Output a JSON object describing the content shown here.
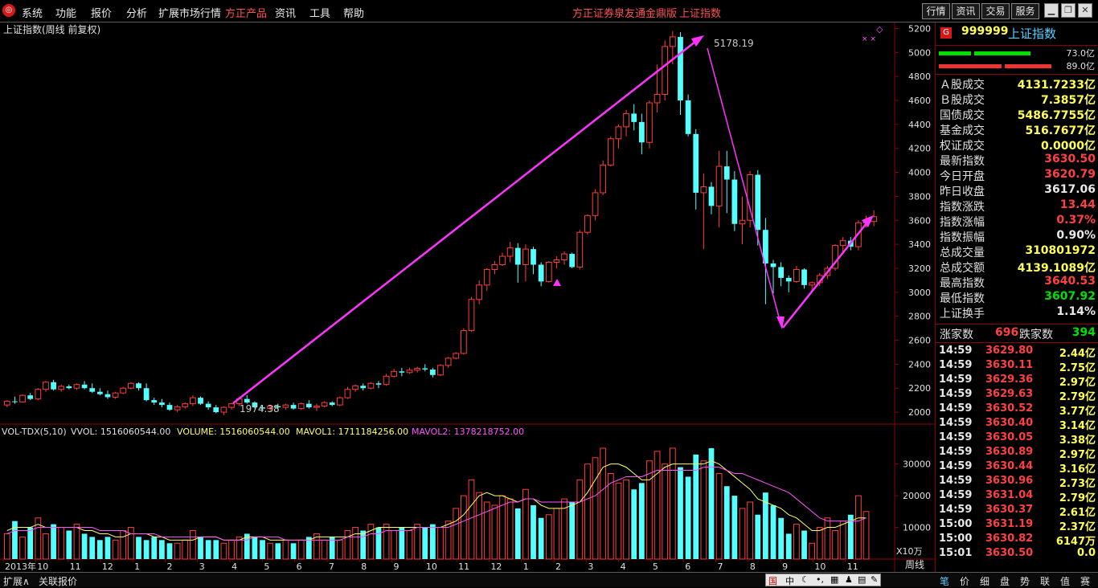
{
  "menubar": {
    "items": [
      "系统",
      "功能",
      "报价",
      "分析",
      "扩展市场行情",
      "方正产品",
      "资讯",
      "工具",
      "帮助"
    ],
    "center_links": [
      "方正证券泉友通金鼎版",
      "上证指数"
    ],
    "right_buttons": [
      "行情",
      "资讯",
      "交易",
      "服务"
    ]
  },
  "chart_title": "上证指数(周线 前复权)",
  "peak_label": "5178.19",
  "low_label": "1974.38",
  "vol_header": {
    "name": "VOL-TDX(5,10)",
    "vvol": "VVOL: 1516060544.00",
    "volume": "VOLUME: 1516060544.00",
    "mavol1": "MAVOL1: 1711184256.00",
    "mavol2": "MAVOL2: 1378218752.00"
  },
  "x10": "X10万",
  "period_label": "周线",
  "bottom_tabs": [
    "扩展∧",
    "关联报价"
  ],
  "colors": {
    "up": "#ff3d3d",
    "down": "#54ffff",
    "ma1": "#ffff66",
    "ma2": "#ff55ff",
    "arrow": "#ff33ff",
    "grid": "#8b0000"
  },
  "chart_data": {
    "type": "candlestick",
    "price_axis": {
      "ticks": [
        2000,
        2200,
        2400,
        2600,
        2800,
        3000,
        3200,
        3400,
        3600,
        3800,
        4000,
        4200,
        4400,
        4600,
        4800,
        5000,
        5200
      ],
      "range": [
        1900,
        5250
      ]
    },
    "volume_axis": {
      "ticks": [
        10000,
        20000,
        30000
      ],
      "range": [
        0,
        36000
      ],
      "unit": "X10万"
    },
    "x_labels": [
      "2013年",
      "10",
      "11",
      "12",
      "1",
      "2",
      "3",
      "4",
      "5",
      "6",
      "7",
      "8",
      "9",
      "10",
      "11",
      "12",
      "1",
      "2",
      "3",
      "4",
      "5",
      "6",
      "7",
      "8",
      "9",
      "10",
      "11"
    ],
    "ohlc": [
      [
        2060,
        2100,
        2040,
        2090
      ],
      [
        2090,
        2130,
        2070,
        2085
      ],
      [
        2085,
        2150,
        2080,
        2140
      ],
      [
        2140,
        2160,
        2100,
        2110
      ],
      [
        2110,
        2200,
        2100,
        2190
      ],
      [
        2190,
        2260,
        2170,
        2250
      ],
      [
        2250,
        2270,
        2180,
        2190
      ],
      [
        2190,
        2230,
        2170,
        2215
      ],
      [
        2215,
        2230,
        2190,
        2200
      ],
      [
        2200,
        2240,
        2185,
        2230
      ],
      [
        2230,
        2260,
        2190,
        2200
      ],
      [
        2200,
        2240,
        2160,
        2170
      ],
      [
        2170,
        2200,
        2140,
        2150
      ],
      [
        2150,
        2180,
        2110,
        2125
      ],
      [
        2125,
        2170,
        2110,
        2160
      ],
      [
        2160,
        2210,
        2150,
        2200
      ],
      [
        2200,
        2250,
        2190,
        2240
      ],
      [
        2240,
        2250,
        2180,
        2200
      ],
      [
        2200,
        2240,
        2090,
        2100
      ],
      [
        2100,
        2120,
        2060,
        2080
      ],
      [
        2080,
        2110,
        2040,
        2060
      ],
      [
        2060,
        2080,
        2010,
        2020
      ],
      [
        2020,
        2060,
        2000,
        2045
      ],
      [
        2045,
        2080,
        2030,
        2070
      ],
      [
        2070,
        2140,
        2050,
        2120
      ],
      [
        2120,
        2130,
        2060,
        2070
      ],
      [
        2070,
        2090,
        2020,
        2040
      ],
      [
        2040,
        2060,
        1990,
        2000
      ],
      [
        2000,
        2050,
        1974,
        2040
      ],
      [
        2040,
        2080,
        2020,
        2070
      ],
      [
        2070,
        2120,
        2050,
        2110
      ],
      [
        2110,
        2140,
        2070,
        2080
      ],
      [
        2080,
        2090,
        2030,
        2040
      ],
      [
        2040,
        2060,
        2010,
        2030
      ],
      [
        2030,
        2060,
        2010,
        2050
      ],
      [
        2050,
        2070,
        2020,
        2040
      ],
      [
        2040,
        2070,
        2020,
        2060
      ],
      [
        2060,
        2080,
        2020,
        2030
      ],
      [
        2030,
        2080,
        2020,
        2070
      ],
      [
        2070,
        2100,
        2030,
        2040
      ],
      [
        2040,
        2070,
        2010,
        2050
      ],
      [
        2050,
        2090,
        2040,
        2080
      ],
      [
        2080,
        2090,
        2050,
        2060
      ],
      [
        2060,
        2130,
        2050,
        2120
      ],
      [
        2120,
        2210,
        2110,
        2190
      ],
      [
        2190,
        2230,
        2170,
        2220
      ],
      [
        2220,
        2240,
        2180,
        2200
      ],
      [
        2200,
        2250,
        2190,
        2240
      ],
      [
        2240,
        2260,
        2200,
        2230
      ],
      [
        2230,
        2320,
        2220,
        2300
      ],
      [
        2300,
        2360,
        2290,
        2340
      ],
      [
        2340,
        2370,
        2300,
        2330
      ],
      [
        2330,
        2370,
        2320,
        2350
      ],
      [
        2350,
        2380,
        2330,
        2365
      ],
      [
        2365,
        2400,
        2340,
        2355
      ],
      [
        2355,
        2370,
        2290,
        2310
      ],
      [
        2310,
        2400,
        2300,
        2390
      ],
      [
        2390,
        2460,
        2370,
        2450
      ],
      [
        2450,
        2500,
        2440,
        2490
      ],
      [
        2490,
        2700,
        2480,
        2680
      ],
      [
        2680,
        2960,
        2670,
        2940
      ],
      [
        2940,
        3100,
        2900,
        3060
      ],
      [
        3060,
        3200,
        3010,
        3190
      ],
      [
        3190,
        3260,
        3150,
        3230
      ],
      [
        3230,
        3330,
        3220,
        3300
      ],
      [
        3300,
        3420,
        3250,
        3370
      ],
      [
        3370,
        3410,
        3080,
        3230
      ],
      [
        3230,
        3400,
        3090,
        3360
      ],
      [
        3360,
        3380,
        3150,
        3230
      ],
      [
        3230,
        3250,
        3050,
        3090
      ],
      [
        3090,
        3260,
        3080,
        3250
      ],
      [
        3250,
        3300,
        3200,
        3270
      ],
      [
        3270,
        3340,
        3230,
        3320
      ],
      [
        3320,
        3330,
        3200,
        3210
      ],
      [
        3210,
        3520,
        3190,
        3500
      ],
      [
        3500,
        3650,
        3480,
        3640
      ],
      [
        3640,
        3860,
        3600,
        3830
      ],
      [
        3830,
        4100,
        3810,
        4060
      ],
      [
        4060,
        4300,
        4050,
        4280
      ],
      [
        4280,
        4400,
        4200,
        4380
      ],
      [
        4380,
        4520,
        4300,
        4490
      ],
      [
        4490,
        4570,
        4350,
        4420
      ],
      [
        4420,
        4490,
        4150,
        4250
      ],
      [
        4250,
        4600,
        4200,
        4580
      ],
      [
        4580,
        4900,
        4500,
        4650
      ],
      [
        4650,
        5100,
        4600,
        5050
      ],
      [
        5050,
        5178,
        4900,
        5130
      ],
      [
        5130,
        5170,
        4480,
        4600
      ],
      [
        4600,
        4650,
        4300,
        4320
      ],
      [
        4320,
        4360,
        3690,
        3830
      ],
      [
        3830,
        3990,
        3360,
        3880
      ],
      [
        3880,
        3920,
        3650,
        3720
      ],
      [
        3720,
        4180,
        3540,
        4050
      ],
      [
        4050,
        4180,
        3660,
        3940
      ],
      [
        3940,
        4010,
        3510,
        3570
      ],
      [
        3570,
        3800,
        3400,
        3600
      ],
      [
        3600,
        4010,
        3540,
        3980
      ],
      [
        3980,
        4020,
        3390,
        3520
      ],
      [
        3520,
        3620,
        2900,
        3240
      ],
      [
        3240,
        3270,
        2990,
        3210
      ],
      [
        3210,
        3250,
        3050,
        3120
      ],
      [
        3120,
        3140,
        3000,
        3090
      ],
      [
        3090,
        3220,
        3080,
        3190
      ],
      [
        3190,
        3200,
        3030,
        3060
      ],
      [
        3060,
        3090,
        3010,
        3080
      ],
      [
        3080,
        3160,
        3050,
        3140
      ],
      [
        3140,
        3220,
        3110,
        3200
      ],
      [
        3200,
        3400,
        3180,
        3390
      ],
      [
        3390,
        3460,
        3320,
        3430
      ],
      [
        3430,
        3460,
        3350,
        3380
      ],
      [
        3380,
        3600,
        3350,
        3580
      ],
      [
        3580,
        3640,
        3540,
        3590
      ],
      [
        3590,
        3684,
        3550,
        3630
      ]
    ],
    "volume": [
      8,
      12,
      7,
      10,
      13,
      8,
      11,
      10,
      9,
      11,
      8,
      7,
      6,
      7,
      6,
      9,
      10,
      7,
      6,
      7,
      6,
      5,
      5,
      6,
      9,
      7,
      6,
      6,
      5,
      6,
      7,
      8,
      7,
      6,
      5,
      5,
      6,
      5,
      6,
      7,
      8,
      6,
      7,
      6,
      9,
      10,
      9,
      11,
      10,
      11,
      9,
      10,
      9,
      11,
      10,
      11,
      10,
      12,
      16,
      20,
      25,
      21,
      18,
      17,
      20,
      19,
      16,
      22,
      17,
      13,
      14,
      16,
      19,
      18,
      25,
      30,
      32,
      35,
      27,
      24,
      25,
      22,
      24,
      31,
      34,
      30,
      35,
      29,
      26,
      33,
      31,
      35,
      27,
      23,
      20,
      16,
      18,
      14,
      21,
      17,
      13,
      8,
      11,
      9,
      5,
      10,
      13,
      9,
      12,
      14,
      20,
      15
    ],
    "mavol1": [
      9,
      10,
      10,
      10,
      11,
      10,
      10,
      10,
      10,
      10,
      9,
      9,
      8,
      8,
      7,
      7,
      8,
      8,
      8,
      7,
      7,
      6,
      6,
      6,
      6,
      7,
      7,
      7,
      6,
      6,
      6,
      7,
      7,
      7,
      6,
      6,
      6,
      6,
      6,
      6,
      7,
      7,
      7,
      7,
      7,
      8,
      8,
      9,
      10,
      10,
      10,
      10,
      10,
      10,
      10,
      10,
      10,
      11,
      12,
      14,
      17,
      20,
      21,
      20,
      20,
      19,
      18,
      19,
      19,
      17,
      16,
      16,
      16,
      17,
      18,
      21,
      25,
      29,
      30,
      30,
      29,
      27,
      25,
      25,
      27,
      29,
      30,
      30,
      30,
      30,
      30,
      31,
      30,
      28,
      26,
      24,
      22,
      19,
      18,
      17,
      16,
      14,
      13,
      11,
      9,
      9,
      10,
      10,
      11,
      12,
      13,
      13
    ],
    "mavol2": [
      8,
      9,
      9,
      9,
      10,
      10,
      10,
      10,
      10,
      10,
      10,
      10,
      9,
      9,
      9,
      9,
      8,
      8,
      8,
      8,
      7,
      7,
      7,
      7,
      7,
      7,
      7,
      7,
      6,
      6,
      6,
      6,
      7,
      7,
      7,
      7,
      6,
      6,
      6,
      6,
      6,
      6,
      6,
      6,
      7,
      7,
      7,
      8,
      8,
      9,
      9,
      9,
      9,
      10,
      10,
      10,
      10,
      10,
      11,
      12,
      13,
      14,
      15,
      16,
      17,
      18,
      18,
      19,
      19,
      18,
      18,
      18,
      18,
      18,
      18,
      19,
      20,
      22,
      24,
      25,
      26,
      26,
      26,
      27,
      28,
      28,
      28,
      28,
      28,
      28,
      29,
      29,
      29,
      28,
      27,
      27,
      26,
      25,
      24,
      23,
      22,
      21,
      19,
      17,
      15,
      13,
      12,
      12,
      12,
      12,
      12,
      13
    ]
  },
  "right_panel": {
    "code": "999999",
    "name": "上证指数",
    "badge": "G",
    "bar1_value": "73.0亿",
    "bar2_value": "89.0亿",
    "stats": [
      {
        "k": "Ａ股成交",
        "v": "4131.7233亿",
        "c": "y"
      },
      {
        "k": "Ｂ股成交",
        "v": "7.3857亿",
        "c": "y"
      },
      {
        "k": "国债成交",
        "v": "5486.7755亿",
        "c": "y"
      },
      {
        "k": "基金成交",
        "v": "516.7677亿",
        "c": "y"
      },
      {
        "k": "权证成交",
        "v": "0.0000亿",
        "c": "y"
      },
      {
        "k": "最新指数",
        "v": "3630.50",
        "c": "r"
      },
      {
        "k": "今日开盘",
        "v": "3620.79",
        "c": "r"
      },
      {
        "k": "昨日收盘",
        "v": "3617.06",
        "c": "w"
      },
      {
        "k": "指数涨跌",
        "v": "13.44",
        "c": "r"
      },
      {
        "k": "指数涨幅",
        "v": "0.37%",
        "c": "r"
      },
      {
        "k": "指数振幅",
        "v": "0.90%",
        "c": "w"
      },
      {
        "k": "总成交量",
        "v": "310801972",
        "c": "y"
      },
      {
        "k": "总成交额",
        "v": "4139.1089亿",
        "c": "y"
      },
      {
        "k": "最高指数",
        "v": "3640.53",
        "c": "r"
      },
      {
        "k": "最低指数",
        "v": "3607.92",
        "c": "g"
      },
      {
        "k": "上证换手",
        "v": "1.14%",
        "c": "w"
      }
    ],
    "up_label": "涨家数",
    "up_count": "696",
    "down_label": "跌家数",
    "down_count": "394",
    "ticks": [
      [
        "14:59",
        "3629.80",
        "2.44亿"
      ],
      [
        "14:59",
        "3630.11",
        "2.75亿"
      ],
      [
        "14:59",
        "3629.36",
        "2.97亿"
      ],
      [
        "14:59",
        "3629.63",
        "2.79亿"
      ],
      [
        "14:59",
        "3630.52",
        "3.77亿"
      ],
      [
        "14:59",
        "3630.40",
        "3.14亿"
      ],
      [
        "14:59",
        "3630.05",
        "3.38亿"
      ],
      [
        "14:59",
        "3630.89",
        "2.97亿"
      ],
      [
        "14:59",
        "3630.44",
        "3.16亿"
      ],
      [
        "14:59",
        "3630.96",
        "2.73亿"
      ],
      [
        "14:59",
        "3631.04",
        "2.79亿"
      ],
      [
        "14:59",
        "3630.37",
        "2.61亿"
      ],
      [
        "15:00",
        "3631.19",
        "2.37亿"
      ],
      [
        "15:00",
        "3630.82",
        "6147万"
      ],
      [
        "15:01",
        "3630.50",
        "0.0"
      ]
    ],
    "tabs": [
      "笔",
      "价",
      "细",
      "盘",
      "势",
      "联",
      "值",
      "赛"
    ]
  }
}
